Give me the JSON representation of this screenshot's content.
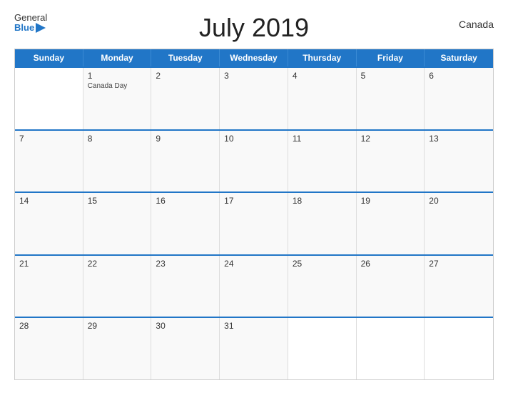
{
  "header": {
    "title": "July 2019",
    "country": "Canada",
    "logo_general": "General",
    "logo_blue": "Blue"
  },
  "days_of_week": [
    "Sunday",
    "Monday",
    "Tuesday",
    "Wednesday",
    "Thursday",
    "Friday",
    "Saturday"
  ],
  "weeks": [
    [
      {
        "day": "",
        "holiday": ""
      },
      {
        "day": "1",
        "holiday": "Canada Day"
      },
      {
        "day": "2",
        "holiday": ""
      },
      {
        "day": "3",
        "holiday": ""
      },
      {
        "day": "4",
        "holiday": ""
      },
      {
        "day": "5",
        "holiday": ""
      },
      {
        "day": "6",
        "holiday": ""
      }
    ],
    [
      {
        "day": "7",
        "holiday": ""
      },
      {
        "day": "8",
        "holiday": ""
      },
      {
        "day": "9",
        "holiday": ""
      },
      {
        "day": "10",
        "holiday": ""
      },
      {
        "day": "11",
        "holiday": ""
      },
      {
        "day": "12",
        "holiday": ""
      },
      {
        "day": "13",
        "holiday": ""
      }
    ],
    [
      {
        "day": "14",
        "holiday": ""
      },
      {
        "day": "15",
        "holiday": ""
      },
      {
        "day": "16",
        "holiday": ""
      },
      {
        "day": "17",
        "holiday": ""
      },
      {
        "day": "18",
        "holiday": ""
      },
      {
        "day": "19",
        "holiday": ""
      },
      {
        "day": "20",
        "holiday": ""
      }
    ],
    [
      {
        "day": "21",
        "holiday": ""
      },
      {
        "day": "22",
        "holiday": ""
      },
      {
        "day": "23",
        "holiday": ""
      },
      {
        "day": "24",
        "holiday": ""
      },
      {
        "day": "25",
        "holiday": ""
      },
      {
        "day": "26",
        "holiday": ""
      },
      {
        "day": "27",
        "holiday": ""
      }
    ],
    [
      {
        "day": "28",
        "holiday": ""
      },
      {
        "day": "29",
        "holiday": ""
      },
      {
        "day": "30",
        "holiday": ""
      },
      {
        "day": "31",
        "holiday": ""
      },
      {
        "day": "",
        "holiday": ""
      },
      {
        "day": "",
        "holiday": ""
      },
      {
        "day": "",
        "holiday": ""
      }
    ]
  ],
  "colors": {
    "header_bg": "#2176c7",
    "accent": "#2176c7"
  }
}
